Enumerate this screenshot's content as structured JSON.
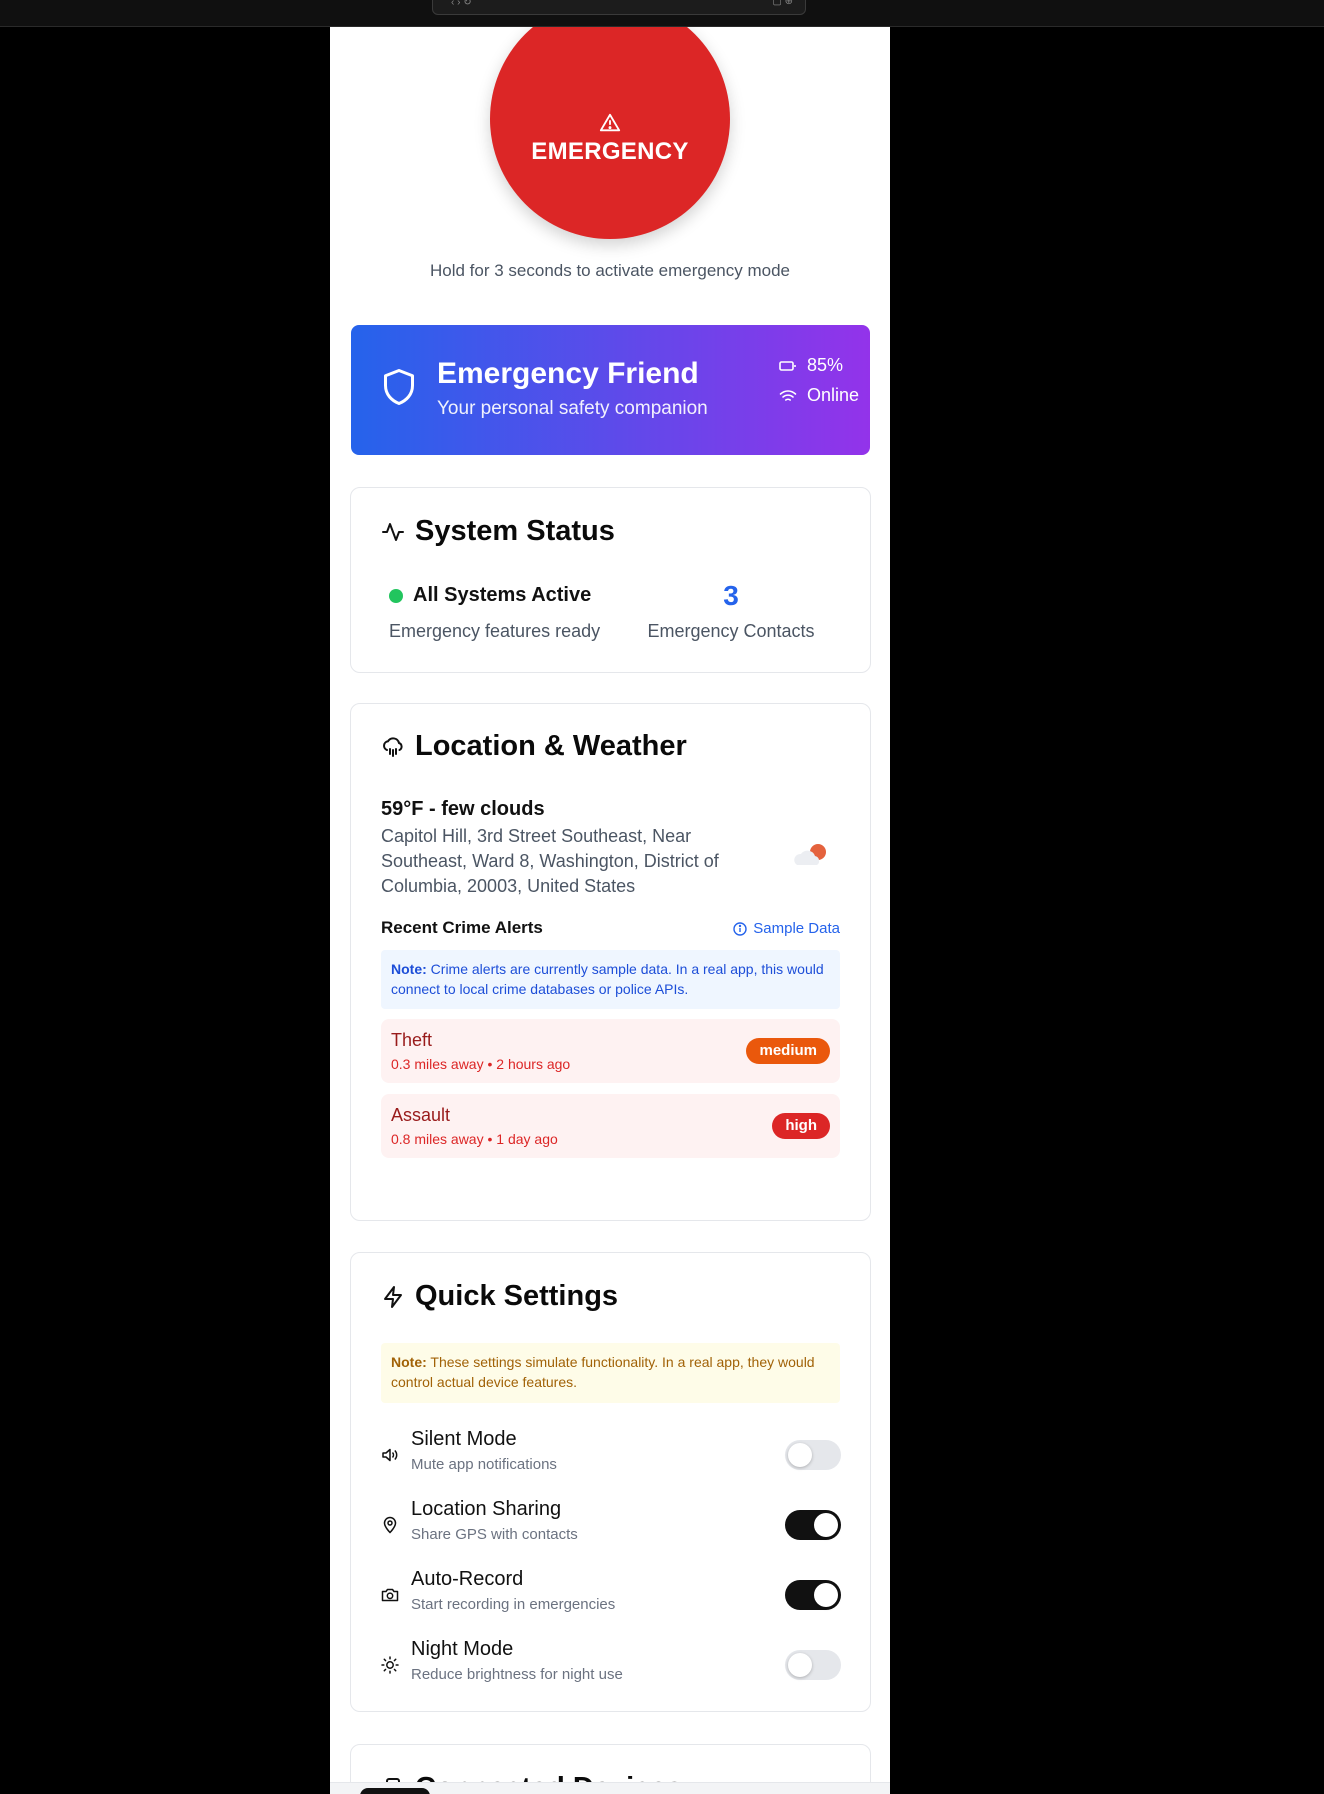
{
  "sos": {
    "label": "EMERGENCY",
    "hint": "Hold for 3 seconds to activate emergency mode"
  },
  "hero": {
    "title": "Emergency Friend",
    "subtitle": "Your personal safety companion",
    "battery": "85%",
    "connection": "Online"
  },
  "status": {
    "title": "System Status",
    "active": "All Systems Active",
    "ready": "Emergency features ready",
    "contacts_count": "3",
    "contacts_label": "Emergency Contacts"
  },
  "location": {
    "title": "Location & Weather",
    "temp": "59°F - few clouds",
    "address": "Capitol Hill, 3rd Street Southeast, Near Southeast, Ward 8, Washington, District of Columbia, 20003, United States",
    "alerts_heading": "Recent Crime Alerts",
    "sample_label": "Sample Data",
    "note_bold": "Note:",
    "note_text": " Crime alerts are currently sample data. In a real app, this would connect to local crime databases or police APIs.",
    "alerts": [
      {
        "name": "Theft",
        "meta": "0.3 miles away • 2 hours ago",
        "severity": "medium"
      },
      {
        "name": "Assault",
        "meta": "0.8 miles away • 1 day ago",
        "severity": "high"
      }
    ]
  },
  "quick": {
    "title": "Quick Settings",
    "note_bold": "Note:",
    "note_text": " These settings simulate functionality. In a real app, they would control actual device features.",
    "settings": [
      {
        "name": "Silent Mode",
        "desc": "Mute app notifications",
        "on": false
      },
      {
        "name": "Location Sharing",
        "desc": "Share GPS with contacts",
        "on": true
      },
      {
        "name": "Auto-Record",
        "desc": "Start recording in emergencies",
        "on": true
      },
      {
        "name": "Night Mode",
        "desc": "Reduce brightness for night use",
        "on": false
      }
    ]
  },
  "devices": {
    "title": "Connected Devices"
  },
  "colors": {
    "sos": "#dc2626",
    "gradient_start": "#2563eb",
    "gradient_end": "#9333ea",
    "active_dot": "#22c55e",
    "medium": "#ea580c",
    "high": "#dc2626"
  },
  "nav": [
    "home-icon",
    "users-icon",
    "clock-icon",
    "shield-icon"
  ]
}
